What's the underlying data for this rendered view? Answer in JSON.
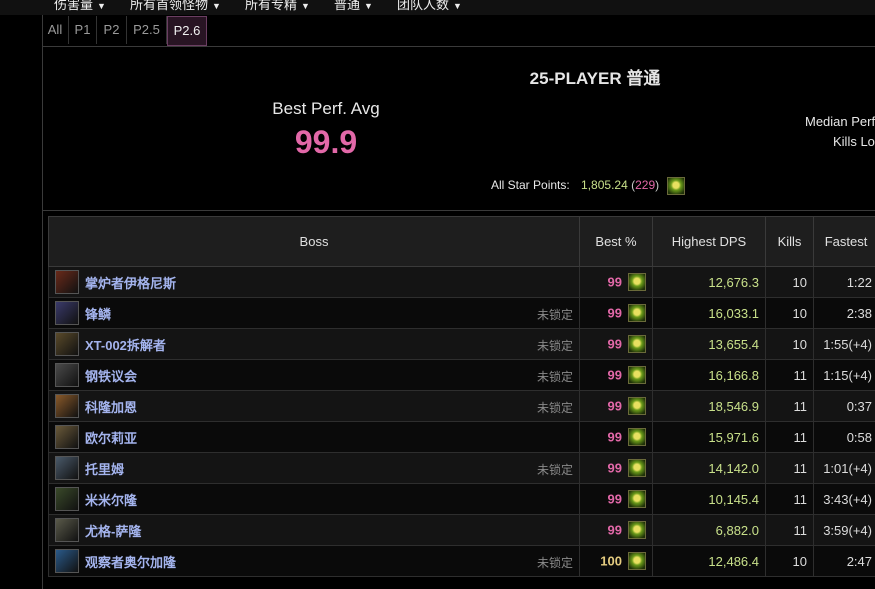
{
  "top_menu": [
    {
      "label": "伤害量"
    },
    {
      "label": "所有首领怪物"
    },
    {
      "label": "所有专精"
    },
    {
      "label": "普通"
    },
    {
      "label": "团队人数"
    }
  ],
  "phase_tabs": [
    {
      "label": "All",
      "active": false
    },
    {
      "label": "P1",
      "active": false
    },
    {
      "label": "P2",
      "active": false
    },
    {
      "label": "P2.5",
      "active": false
    },
    {
      "label": "P2.6",
      "active": true
    }
  ],
  "summary": {
    "raid_title": "25-PLAYER 普通",
    "best_perf_label": "Best Perf. Avg",
    "best_perf_value": "99.9",
    "median_label": "Median Perf",
    "kills_label": "Kills Lo",
    "star_points_label": "All Star Points:",
    "star_points_value": "1,805.24",
    "star_points_rank": "229",
    "open_paren": "(",
    "close_paren": ")"
  },
  "table": {
    "headers": {
      "boss": "Boss",
      "best": "Best %",
      "dps": "Highest DPS",
      "kills": "Kills",
      "fastest": "Fastest"
    },
    "rows": [
      {
        "boss": "掌炉者伊格尼斯",
        "locked_label": "",
        "best": "99",
        "dps": "12,676.3",
        "kills": "10",
        "fastest": "1:22",
        "icon_color": "#6a2a1a"
      },
      {
        "boss": "锋鳞",
        "locked_label": "未锁定",
        "best": "99",
        "dps": "16,033.1",
        "kills": "10",
        "fastest": "2:38",
        "icon_color": "#3a3a6a"
      },
      {
        "boss": "XT-002拆解者",
        "locked_label": "未锁定",
        "best": "99",
        "dps": "13,655.4",
        "kills": "10",
        "fastest": "1:55(+4)",
        "icon_color": "#5a4a2a"
      },
      {
        "boss": "钢铁议会",
        "locked_label": "未锁定",
        "best": "99",
        "dps": "16,166.8",
        "kills": "11",
        "fastest": "1:15(+4)",
        "icon_color": "#4a4a4a"
      },
      {
        "boss": "科隆加恩",
        "locked_label": "未锁定",
        "best": "99",
        "dps": "18,546.9",
        "kills": "11",
        "fastest": "0:37",
        "icon_color": "#8a5a2a"
      },
      {
        "boss": "欧尔莉亚",
        "locked_label": "",
        "best": "99",
        "dps": "15,971.6",
        "kills": "11",
        "fastest": "0:58",
        "icon_color": "#6a5a3a"
      },
      {
        "boss": "托里姆",
        "locked_label": "未锁定",
        "best": "99",
        "dps": "14,142.0",
        "kills": "11",
        "fastest": "1:01(+4)",
        "icon_color": "#4a5a6a"
      },
      {
        "boss": "米米尔隆",
        "locked_label": "",
        "best": "99",
        "dps": "10,145.4",
        "kills": "11",
        "fastest": "3:43(+4)",
        "icon_color": "#3a4a2a"
      },
      {
        "boss": "尤格-萨隆",
        "locked_label": "",
        "best": "99",
        "dps": "6,882.0",
        "kills": "11",
        "fastest": "3:59(+4)",
        "icon_color": "#5a5a4a"
      },
      {
        "boss": "观察者奥尔加隆",
        "locked_label": "未锁定",
        "best": "100",
        "dps": "12,486.4",
        "kills": "10",
        "fastest": "2:47",
        "icon_color": "#2a5a8a"
      }
    ]
  },
  "colors": {
    "perf_pink": "#e268a8",
    "perf_gold": "#e5cc80",
    "dps_green": "#c8e08a",
    "boss_blue": "#a4b4ee"
  }
}
